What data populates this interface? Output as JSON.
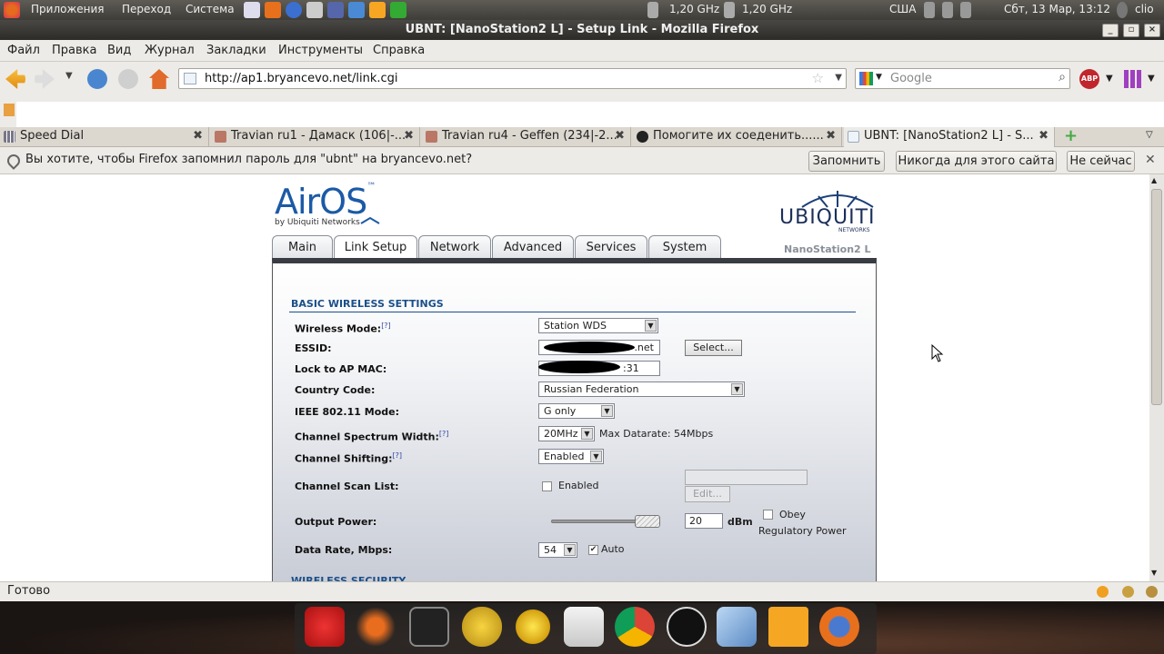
{
  "gnome_panel": {
    "apps": "Приложения",
    "places": "Переход",
    "system": "Система",
    "cpu1": "1,20 GHz",
    "cpu2": "1,20 GHz",
    "kbd": "США",
    "datetime": "Сбт, 13 Мар, 13:12",
    "user": "clio"
  },
  "window": {
    "title": "UBNT: [NanoStation2 L] - Setup Link - Mozilla Firefox"
  },
  "menu": [
    "Файл",
    "Правка",
    "Вид",
    "Журнал",
    "Закладки",
    "Инструменты",
    "Справка"
  ],
  "nav": {
    "url": "http://ap1.bryancevo.net/link.cgi",
    "search_placeholder": "Google"
  },
  "tabs": [
    {
      "label": "Speed Dial"
    },
    {
      "label": "Travian ru1 - Дамаск (106|-..."
    },
    {
      "label": "Travian ru4 - Geffen (234|-2..."
    },
    {
      "label": "Помогите их соеденить......"
    },
    {
      "label": "UBNT: [NanoStation2 L] - S..."
    }
  ],
  "password_bar": {
    "message": "Вы хотите, чтобы Firefox запомнил пароль для \"ubnt\" на bryancevo.net?",
    "remember": "Запомнить",
    "never": "Никогда для этого сайта",
    "not_now": "Не сейчас"
  },
  "ubnt": {
    "logo": "AirOS",
    "logo_tm": "™",
    "logo_by": "by Ubiquiti Networks",
    "brand": "UBIQUITI",
    "brand_sub": "NETWORKS",
    "device": "NanoStation2 L",
    "tabs": [
      "Main",
      "Link Setup",
      "Network",
      "Advanced",
      "Services",
      "System"
    ],
    "section": "BASIC WIRELESS SETTINGS",
    "help_marker": "[?]",
    "fields": {
      "wireless_mode": {
        "label": "Wireless Mode:",
        "value": "Station WDS"
      },
      "essid": {
        "label": "ESSID:",
        "value": ".net",
        "button": "Select..."
      },
      "lock_ap": {
        "label": "Lock to AP MAC:",
        "value": ":31"
      },
      "country": {
        "label": "Country Code:",
        "value": "Russian Federation"
      },
      "ieee": {
        "label": "IEEE 802.11 Mode:",
        "value": "G only"
      },
      "spectrum": {
        "label": "Channel Spectrum Width:",
        "value": "20MHz",
        "extra": "Max Datarate: 54Mbps"
      },
      "shifting": {
        "label": "Channel Shifting:",
        "value": "Enabled"
      },
      "scan": {
        "label": "Channel Scan List:",
        "check_label": "Enabled",
        "button": "Edit..."
      },
      "power": {
        "label": "Output Power:",
        "value": "20",
        "unit": "dBm",
        "obey1": "Obey",
        "obey2": "Regulatory Power"
      },
      "rate": {
        "label": "Data Rate, Mbps:",
        "value": "54",
        "auto": "Auto"
      },
      "next_section": "WIRELESS SECURITY"
    }
  },
  "status": {
    "text": "Готово"
  },
  "colors": {
    "accent": "#1b5aa6",
    "section": "#1a4f8a"
  }
}
